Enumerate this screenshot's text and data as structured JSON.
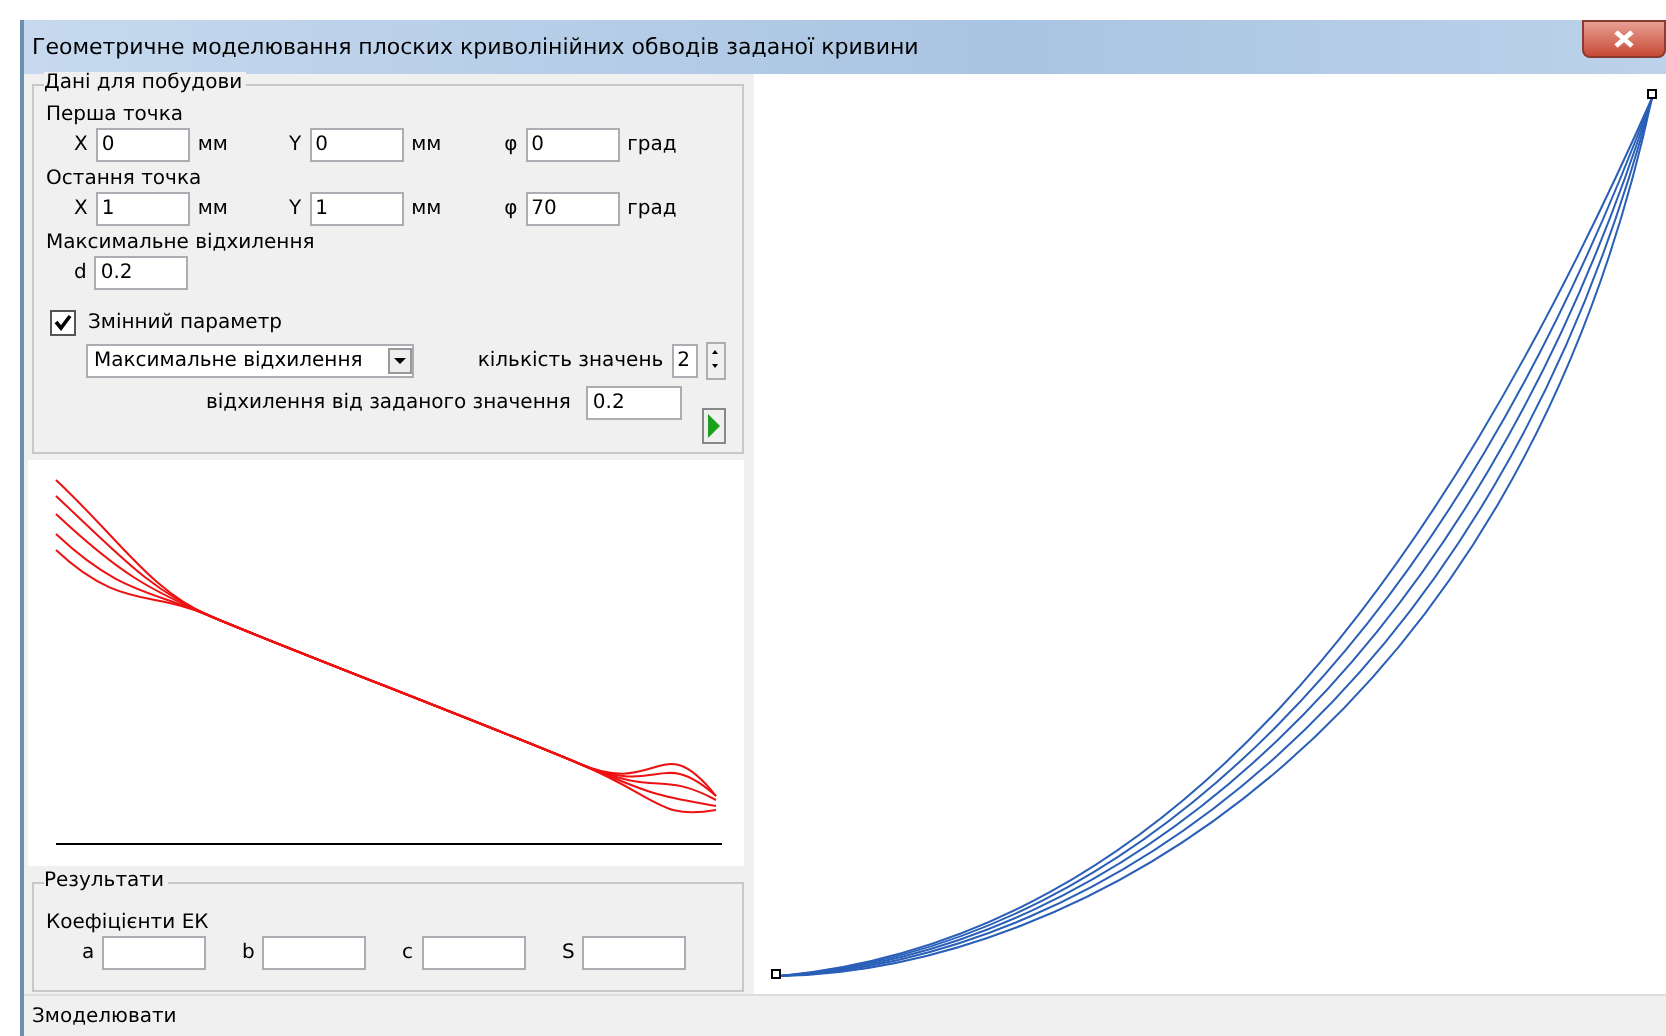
{
  "window": {
    "title": "Геометричне моделювання плоских криволінійних обводів заданої кривини"
  },
  "input_group": {
    "title": "Дані для побудови",
    "first_point": {
      "label": "Перша точка",
      "fields": [
        {
          "label": "X",
          "value": "0",
          "unit": "мм"
        },
        {
          "label": "Y",
          "value": "0",
          "unit": "мм"
        },
        {
          "label": "φ",
          "value": "0",
          "unit": "град"
        }
      ]
    },
    "last_point": {
      "label": "Остання точка",
      "fields": [
        {
          "label": "X",
          "value": "1",
          "unit": "мм"
        },
        {
          "label": "Y",
          "value": "1",
          "unit": "мм"
        },
        {
          "label": "φ",
          "value": "70",
          "unit": "град"
        }
      ]
    },
    "max_deviation": {
      "label": "Максимальне відхилення",
      "field_label": "d",
      "value": "0.2"
    },
    "variable_parameter": {
      "label": "Змінний параметр",
      "checked": true
    },
    "parameter_select": {
      "value": "Максимальне відхилення"
    },
    "count": {
      "label": "кількість значень",
      "value": "2"
    },
    "deviation": {
      "label": "відхилення від заданого значення",
      "value": "0.2"
    }
  },
  "results": {
    "title": "Результати",
    "subtitle": "Коефіцієнти ЕК",
    "fields": [
      {
        "label": "a"
      },
      {
        "label": "b"
      },
      {
        "label": "c"
      },
      {
        "label": "S"
      }
    ]
  },
  "status_bar": {
    "text": "Змоделювати"
  }
}
